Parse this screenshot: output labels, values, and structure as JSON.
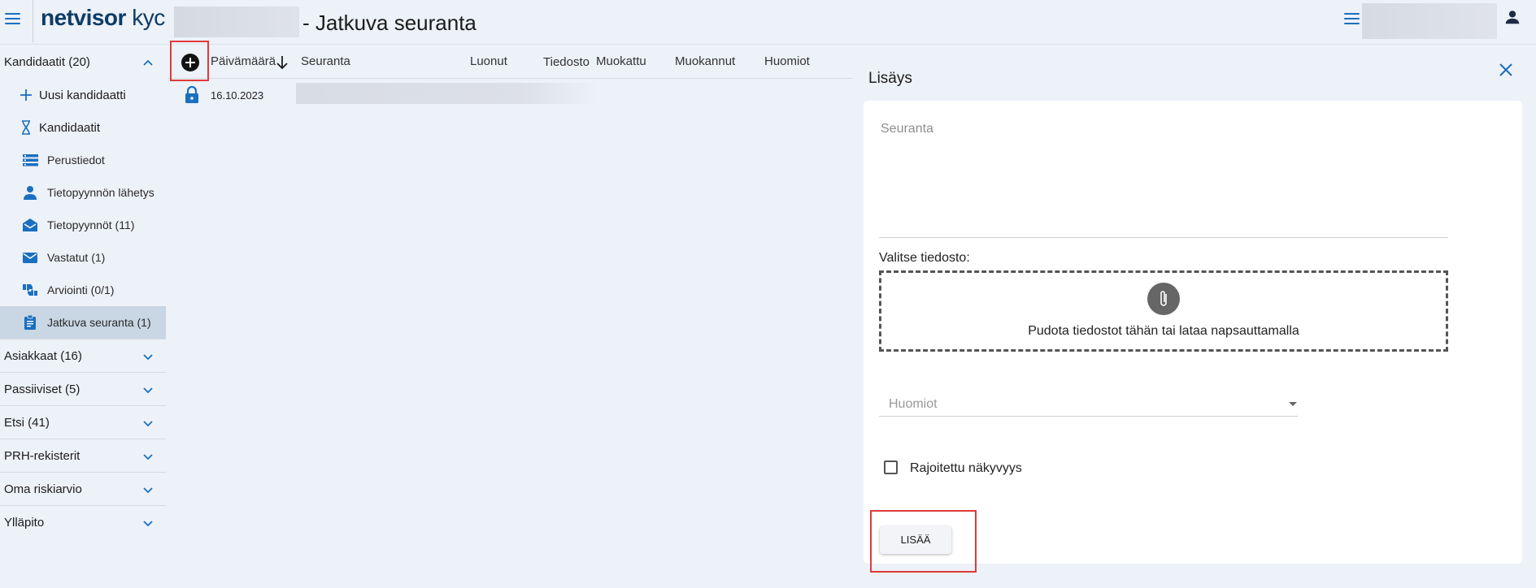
{
  "header": {
    "logo_brand": "netvisor",
    "logo_product": " kyc",
    "page_title": "- Jatkuva seuranta"
  },
  "sidebar": {
    "groups": [
      {
        "label": "Kandidaatit (20)",
        "expanded": true,
        "items": [
          {
            "label": "Uusi kandidaatti",
            "icon": "plus-icon"
          },
          {
            "label": "Kandidaatit",
            "icon": "hourglass-icon"
          },
          {
            "label": "Perustiedot",
            "icon": "list-icon"
          },
          {
            "label": "Tietopyynnön lähetys",
            "icon": "person-icon"
          },
          {
            "label": "Tietopyynnöt (11)",
            "icon": "open-mail-icon"
          },
          {
            "label": "Vastatut (1)",
            "icon": "mail-icon"
          },
          {
            "label": "Arviointi (0/1)",
            "icon": "thumbs-icon"
          },
          {
            "label": "Jatkuva seuranta (1)",
            "icon": "clipboard-icon",
            "active": true
          }
        ]
      },
      {
        "label": "Asiakkaat (16)"
      },
      {
        "label": "Passiiviset (5)"
      },
      {
        "label": "Etsi (41)"
      },
      {
        "label": "PRH-rekisterit"
      },
      {
        "label": "Oma riskiarvio"
      },
      {
        "label": "Ylläpito"
      }
    ]
  },
  "table": {
    "columns": [
      "Päivämäärä",
      "Seuranta",
      "Luonut",
      "Tiedosto",
      "Muokattu",
      "Muokannut",
      "Huomiot"
    ],
    "sort_column": "Päivämäärä",
    "rows": [
      {
        "date": "16.10.2023",
        "locked": true
      }
    ]
  },
  "panel": {
    "title": "Lisäys",
    "seuranta_placeholder": "Seuranta",
    "file_label": "Valitse tiedosto:",
    "dropzone_text": "Pudota tiedostot tähän tai lataa napsauttamalla",
    "huomiot_placeholder": "Huomiot",
    "checkbox_label": "Rajoitettu näkyvyys",
    "checkbox_checked": false,
    "submit_label": "LISÄÄ"
  },
  "colors": {
    "accent": "#1a6fc0",
    "background": "#edf1f8",
    "active_item": "#c9d6e3",
    "highlight": "#e03a3a"
  }
}
